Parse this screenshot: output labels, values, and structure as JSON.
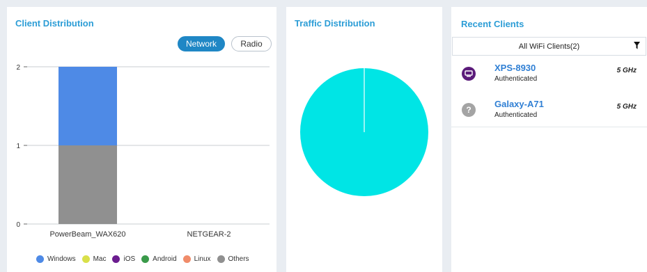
{
  "client_distribution": {
    "title": "Client Distribution",
    "toggle_network": "Network",
    "toggle_radio": "Radio",
    "chart_data": {
      "type": "bar",
      "stacked": true,
      "categories": [
        "PowerBeam_WAX620",
        "NETGEAR-2"
      ],
      "series": [
        {
          "name": "Windows",
          "color": "#4e8ae6",
          "values": [
            1,
            0
          ]
        },
        {
          "name": "Mac",
          "color": "#d9e04a",
          "values": [
            0,
            0
          ]
        },
        {
          "name": "iOS",
          "color": "#6b1d8f",
          "values": [
            0,
            0
          ]
        },
        {
          "name": "Android",
          "color": "#3a9a4a",
          "values": [
            0,
            0
          ]
        },
        {
          "name": "Linux",
          "color": "#f08c6a",
          "values": [
            0,
            0
          ]
        },
        {
          "name": "Others",
          "color": "#909090",
          "values": [
            1,
            0
          ]
        }
      ],
      "stack_order": [
        "Others",
        "Windows"
      ],
      "y_ticks": [
        "0",
        "1",
        "2"
      ],
      "ylim": [
        0,
        2
      ],
      "grid": true,
      "legend_position": "bottom"
    }
  },
  "traffic_distribution": {
    "title": "Traffic Distribution",
    "chart_data": {
      "type": "pie",
      "slices": [
        {
          "value": 100,
          "color": "#00e5e5"
        }
      ]
    }
  },
  "recent_clients": {
    "title": "Recent Clients",
    "filter_label": "All WiFi Clients(2)",
    "clients": [
      {
        "name": "XPS-8930",
        "status": "Authenticated",
        "band": "5 GHz",
        "icon": "computer-icon",
        "icon_color": "#5b1b7a"
      },
      {
        "name": "Galaxy-A71",
        "status": "Authenticated",
        "band": "5 GHz",
        "icon": "unknown-device-icon",
        "icon_color": "#a4a4a4"
      }
    ]
  }
}
